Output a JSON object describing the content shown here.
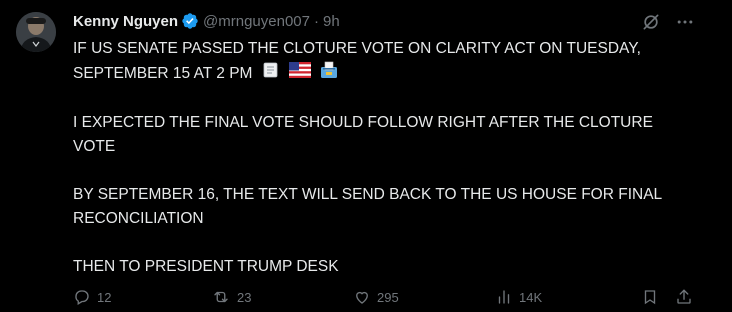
{
  "author": {
    "display_name": "Kenny Nguyen",
    "handle": "@mrnguyen007",
    "separator": "·",
    "time": "9h"
  },
  "icons": {
    "verified": "verified-badge-icon",
    "grok": "grok-slash-icon",
    "more": "more-horizontal-icon"
  },
  "body": {
    "p1_text": "IF US SENATE PASSED THE CLOTURE VOTE ON CLARITY ACT ON TUESDAY, SEPTEMBER 15 AT 2 PM",
    "p1_emojis": [
      "scroll-emoji",
      "us-flag-emoji",
      "ballot-box-emoji"
    ],
    "p2": "I EXPECTED THE FINAL VOTE SHOULD FOLLOW RIGHT AFTER THE CLOTURE VOTE",
    "p3": "BY SEPTEMBER 16, THE TEXT WILL SEND BACK TO THE US HOUSE FOR FINAL RECONCILIATION",
    "p4": "THEN TO PRESIDENT TRUMP DESK"
  },
  "actions": {
    "replies": "12",
    "reposts": "23",
    "likes": "295",
    "views": "14K"
  },
  "colors": {
    "background": "#000000",
    "text": "#e7e9ea",
    "muted": "#71767b",
    "verified": "#1d9bf0"
  }
}
